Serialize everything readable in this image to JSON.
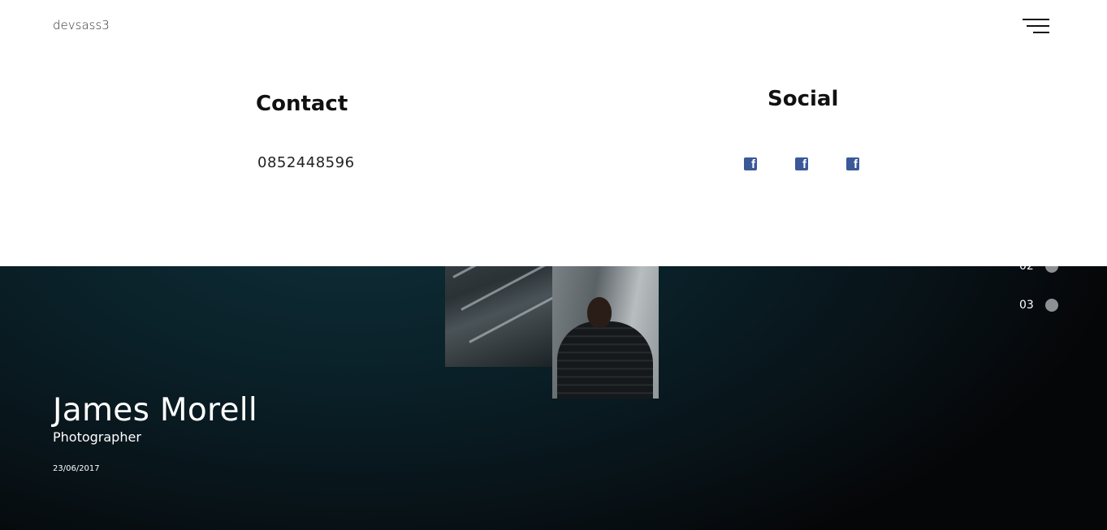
{
  "header": {
    "brand": "devsass3",
    "menu_icon": "hamburger-menu-icon"
  },
  "contact": {
    "heading": "Contact",
    "phone": "0852448596"
  },
  "social": {
    "heading": "Social",
    "links": [
      {
        "icon": "facebook-icon",
        "glyph": "f"
      },
      {
        "icon": "facebook-icon",
        "glyph": "f"
      },
      {
        "icon": "facebook-icon",
        "glyph": "f"
      }
    ],
    "brand_color": "#3b5998"
  },
  "hero": {
    "name": "James Morell",
    "role": "Photographer",
    "date": "23/06/2017"
  },
  "slide_nav": {
    "items": [
      {
        "label": "02"
      },
      {
        "label": "03"
      }
    ]
  },
  "colors": {
    "overlay_bg": "#ffffff",
    "hero_bg": "#0a2129",
    "dot": "#8d9194"
  }
}
